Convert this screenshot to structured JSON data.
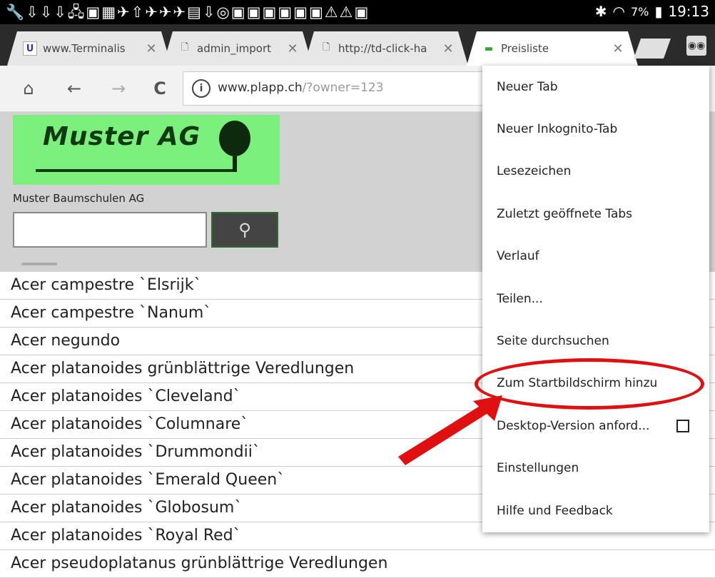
{
  "status_bar": {
    "notification_icons": "🔧⇩⇩⇩🖧▣▦✈⇧✈✈✈▤⇩◎▣▣▣▣▣▣⚠⚠▣",
    "bluetooth_icon": "bluetooth-icon",
    "wifi_icon": "wifi-icon",
    "battery": "7%",
    "time": "19:13"
  },
  "tabs": [
    {
      "title": "www.Terminalis",
      "favicon": "U",
      "close": "✕"
    },
    {
      "title": "admin_import",
      "favicon": "🗋",
      "close": "✕"
    },
    {
      "title": "http://td-click-ha",
      "favicon": "🗋",
      "close": "✕"
    },
    {
      "title": "Preisliste",
      "favicon": "▬",
      "close": "✕"
    }
  ],
  "toolbar": {
    "home_icon": "⌂",
    "back_icon": "←",
    "forward_icon": "→",
    "reload_icon": "C",
    "info_icon": "i",
    "url_host": "www.plapp.ch",
    "url_path": "/?owner=123"
  },
  "page": {
    "logo_text": "Muster AG",
    "company_name": "Muster Baumschulen AG",
    "search_placeholder": "",
    "search_icon": "⚲"
  },
  "plants": [
    "Acer campestre `Elsrijk`",
    "Acer campestre `Nanum`",
    "Acer negundo",
    "Acer platanoides grünblättrige Veredlungen",
    "Acer platanoides `Cleveland`",
    "Acer platanoides `Columnare`",
    "Acer platanoides `Drummondii`",
    "Acer platanoides `Emerald Queen`",
    "Acer platanoides `Globosum`",
    "Acer platanoides `Royal Red`",
    "Acer pseudoplatanus grünblättrige Veredlungen"
  ],
  "menu": [
    "Neuer Tab",
    "Neuer Inkognito-Tab",
    "Lesezeichen",
    "Zuletzt geöffnete Tabs",
    "Verlauf",
    "Teilen...",
    "Seite durchsuchen",
    "Zum Startbildschirm hinzu",
    "Desktop-Version anford...",
    "Einstellungen",
    "Hilfe und Feedback"
  ]
}
